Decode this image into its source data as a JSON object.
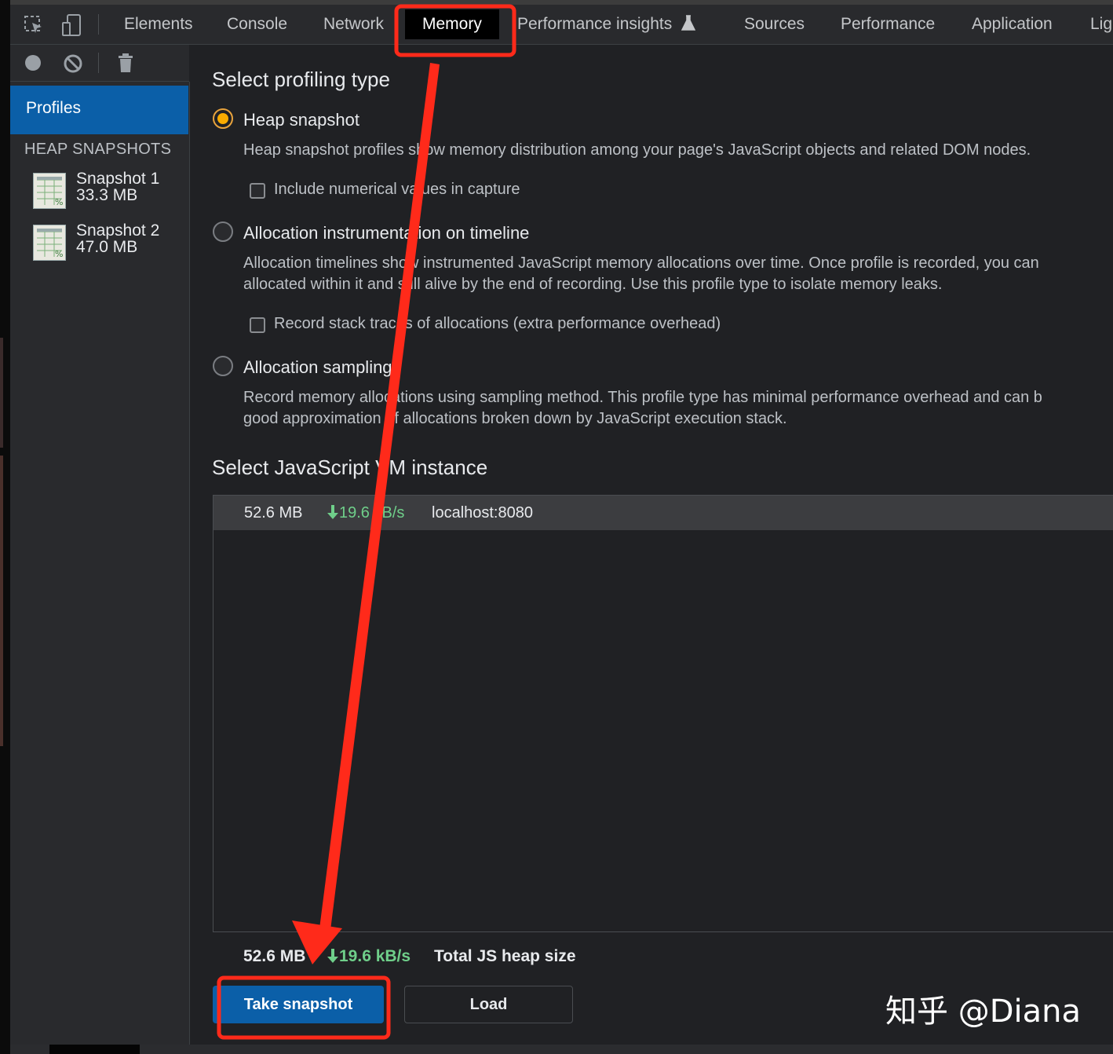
{
  "tabs": {
    "elements": "Elements",
    "console": "Console",
    "network": "Network",
    "memory": "Memory",
    "performance_insights": "Performance insights",
    "sources": "Sources",
    "performance": "Performance",
    "application": "Application",
    "lighthouse_truncated": "Lig"
  },
  "sidebar": {
    "profiles_label": "Profiles",
    "section_header": "HEAP SNAPSHOTS",
    "snapshots": [
      {
        "name": "Snapshot 1",
        "size": "33.3 MB"
      },
      {
        "name": "Snapshot 2",
        "size": "47.0 MB"
      }
    ]
  },
  "main": {
    "profiling_title": "Select profiling type",
    "options": [
      {
        "label": "Heap snapshot",
        "selected": true,
        "description": [
          "Heap snapshot profiles show memory distribution among your page's JavaScript objects and related DOM nodes."
        ],
        "checkbox": "Include numerical values in capture"
      },
      {
        "label": "Allocation instrumentation on timeline",
        "selected": false,
        "description": [
          "Allocation timelines show instrumented JavaScript memory allocations over time. Once profile is recorded, you can",
          "allocated within it and still alive by the end of recording. Use this profile type to isolate memory leaks."
        ],
        "checkbox": "Record stack traces of allocations (extra performance overhead)"
      },
      {
        "label": "Allocation sampling",
        "selected": false,
        "description": [
          "Record memory allocations using sampling method. This profile type has minimal performance overhead and can b",
          "good approximation of allocations broken down by JavaScript execution stack."
        ]
      }
    ],
    "vm_title": "Select JavaScript VM instance",
    "vm_row": {
      "heap": "52.6 MB",
      "rate": "19.6 kB/s",
      "target": "localhost:8080"
    },
    "footer": {
      "heap": "52.6 MB",
      "rate": "19.6 kB/s",
      "label": "Total JS heap size"
    },
    "take_snapshot": "Take snapshot",
    "load": "Load"
  },
  "watermark": "知乎 @Diana",
  "colors": {
    "accent_blue": "#0b5fa8",
    "annotation_red": "#ff2a1a",
    "radio_selected": "#f9ab00",
    "rate_green": "#6fcf8a"
  }
}
